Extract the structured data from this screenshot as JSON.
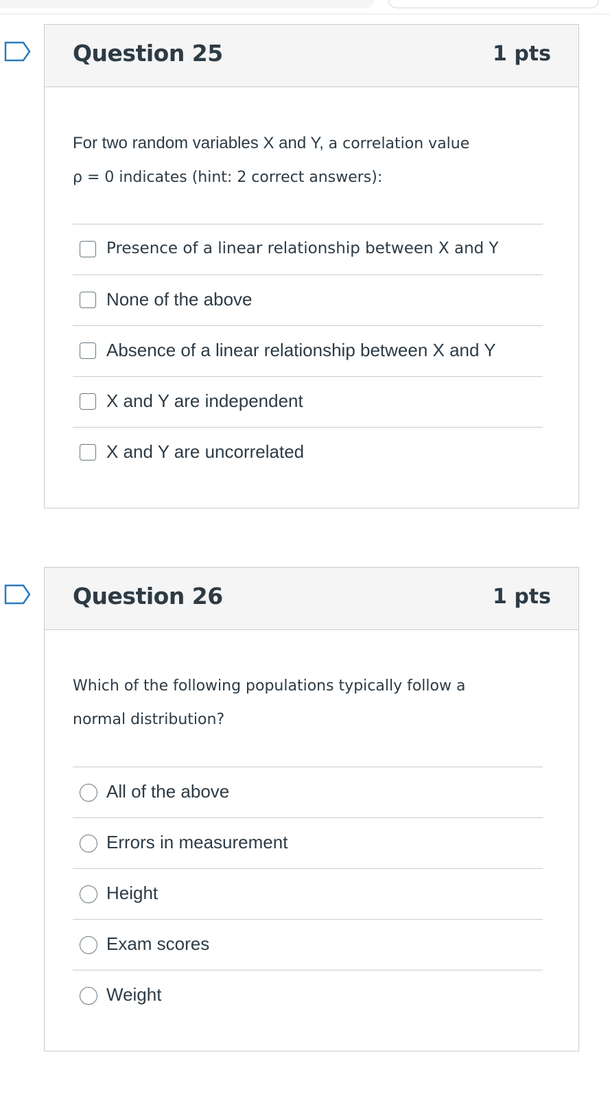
{
  "questions": [
    {
      "title": "Question 25",
      "points": "1 pts",
      "text_part1": "For two random variables X and Y, ",
      "text_part2": "a correlation value",
      "text_line2": "ρ = 0 indicates (hint: 2 correct answers):",
      "answer_type": "checkbox",
      "answers": [
        "Presence of a linear relationship between X and Y",
        "None of the above",
        "Absence of a linear relationship between X and Y",
        "X and Y are independent",
        "X and Y are uncorrelated"
      ]
    },
    {
      "title": "Question 26",
      "points": "1 pts",
      "text_line1": "Which of the following populations typically follow a",
      "text_line2": "normal distribution?",
      "answer_type": "radio",
      "answers": [
        "All of the above",
        "Errors in measurement",
        "Height",
        "Exam scores",
        "Weight"
      ]
    }
  ],
  "colors": {
    "text": "#2d3b45",
    "header_bg": "#f5f5f5",
    "border": "#c7cdd1",
    "flag": "#2b7abc"
  },
  "icons": {
    "flag": "bookmark-flag-icon"
  }
}
